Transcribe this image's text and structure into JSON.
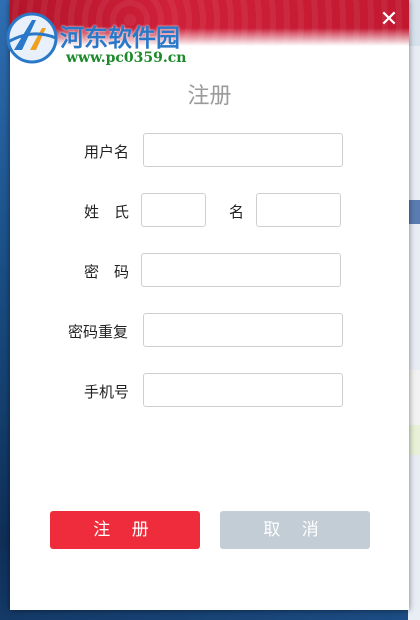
{
  "watermark": {
    "site_name": "河东软件园",
    "url": "www.pc0359.cn"
  },
  "dialog": {
    "close_glyph": "✕",
    "heading": "注册"
  },
  "form": {
    "username_label": "用户名",
    "surname_label": "姓　氏",
    "givenname_label": "名",
    "password_label": "密　码",
    "password_repeat_label": "密码重复",
    "phone_label": "手机号",
    "username_value": "",
    "surname_value": "",
    "givenname_value": "",
    "password_value": "",
    "password_repeat_value": "",
    "phone_value": ""
  },
  "buttons": {
    "register": "注 册",
    "cancel": "取 消"
  },
  "colors": {
    "title_bar": "#c11830",
    "register_button": "#ef2c3c",
    "cancel_button": "#c3cdd6",
    "heading_text": "#9a9a9a"
  }
}
